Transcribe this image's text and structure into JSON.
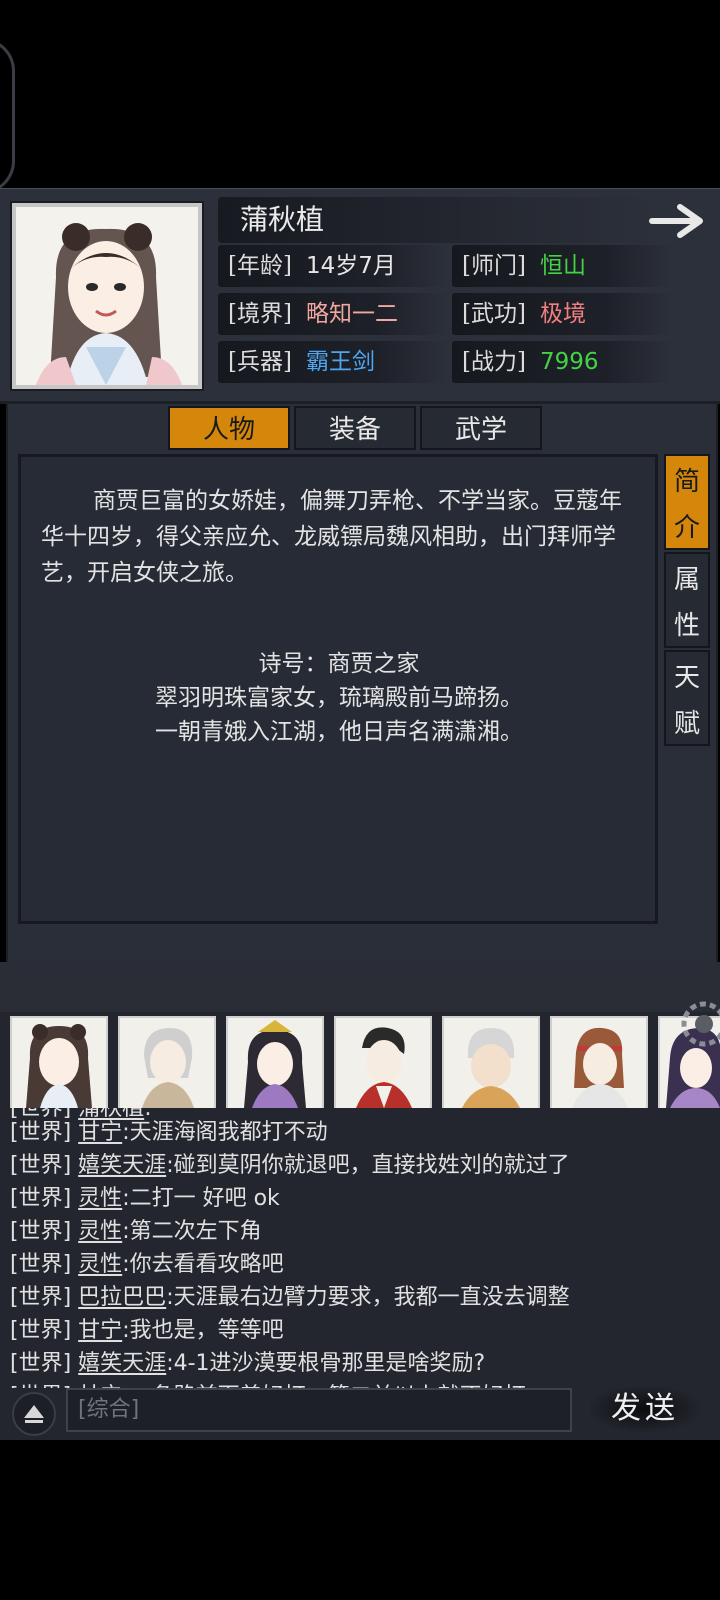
{
  "profile": {
    "name": "蒲秋植",
    "stats": [
      {
        "label": "[年龄]",
        "value": "14岁7月",
        "color": "#e6e6e6"
      },
      {
        "label": "[师门]",
        "value": "恒山",
        "color": "#46d246"
      },
      {
        "label": "[境界]",
        "value": "略知一二",
        "color": "#f0a7a0"
      },
      {
        "label": "[武功]",
        "value": "极境",
        "color": "#f08080"
      },
      {
        "label": "[兵器]",
        "value": "霸王剑",
        "color": "#4da6f0"
      },
      {
        "label": "[战力]",
        "value": "7996",
        "color": "#46d246"
      }
    ]
  },
  "tabs": [
    "人物",
    "装备",
    "武学"
  ],
  "side_tabs": [
    {
      "c1": "简",
      "c2": "介"
    },
    {
      "c1": "属",
      "c2": "性"
    },
    {
      "c1": "天",
      "c2": "赋"
    }
  ],
  "intro": {
    "text": "商贾巨富的女娇娃，偏舞刀弄枪、不学当家。豆蔻年华十四岁，得父亲应允、龙威镖局魏风相助，出门拜师学艺，开启女侠之旅。",
    "poem_title": "诗号：商贾之家",
    "poem_line1": "翠羽明珠富家女，琉璃殿前马蹄扬。",
    "poem_line2": "一朝青娥入江湖，他日声名满潇湘。"
  },
  "chat": {
    "partial_top": {
      "channel": "[世界]",
      "user": "蒲秋植",
      "msg": ":"
    },
    "lines": [
      {
        "channel": "[世界]",
        "user": "甘宁",
        "msg": ":天涯海阁我都打不动"
      },
      {
        "channel": "[世界]",
        "user": "嬉笑天涯",
        "msg": ":碰到莫阴你就退吧，直接找姓刘的就过了"
      },
      {
        "channel": "[世界]",
        "user": "灵性",
        "msg": ":二打一 好吧 ok"
      },
      {
        "channel": "[世界]",
        "user": "灵性",
        "msg": ":第二次左下角"
      },
      {
        "channel": "[世界]",
        "user": "灵性",
        "msg": ":你去看看攻略吧"
      },
      {
        "channel": "[世界]",
        "user": "巴拉巴巴",
        "msg": ":天涯最右边臂力要求，我都一直没去调整"
      },
      {
        "channel": "[世界]",
        "user": "甘宁",
        "msg": ":我也是，等等吧"
      },
      {
        "channel": "[世界]",
        "user": "嬉笑天涯",
        "msg": ":4-1进沙漠要根骨那里是啥奖励?"
      }
    ],
    "partial_bottom": {
      "channel": "[世界]",
      "user": "甘宁",
      "msg": ":一条路前面差好打，第二关以上就不好打"
    },
    "input_placeholder": "[综合]",
    "send_label": "发送"
  }
}
